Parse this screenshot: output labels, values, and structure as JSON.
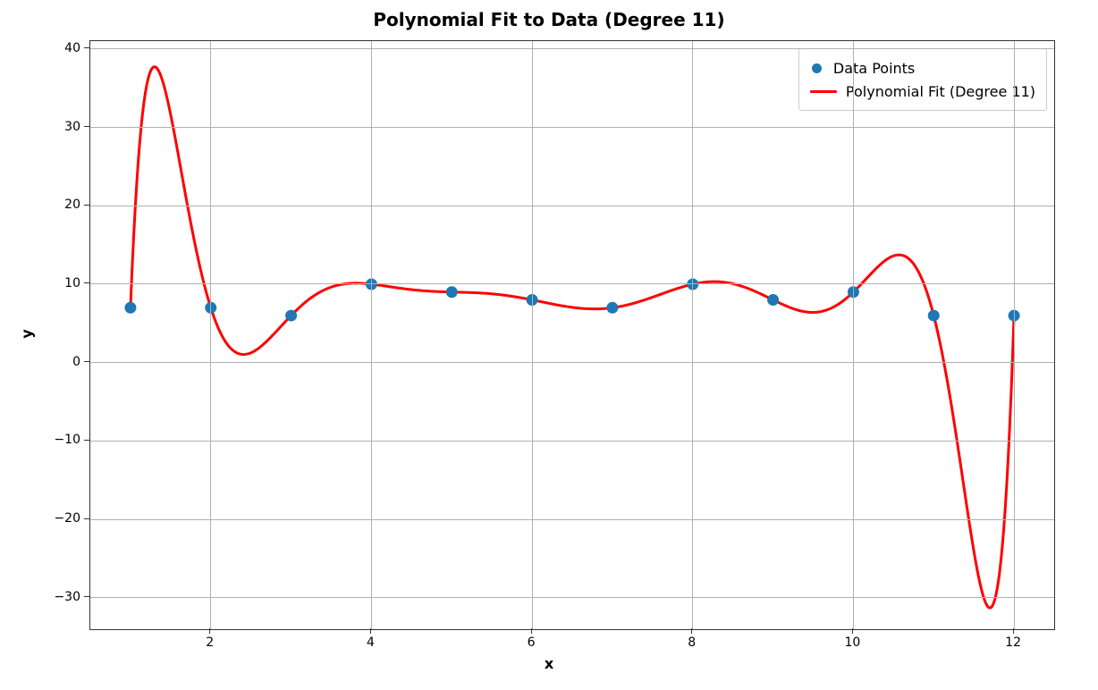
{
  "chart_data": {
    "type": "line",
    "title": "Polynomial Fit to Data (Degree 11)",
    "xlabel": "x",
    "ylabel": "y",
    "xticks": [
      2,
      4,
      6,
      8,
      10,
      12
    ],
    "yticks": [
      -30,
      -20,
      -10,
      0,
      10,
      20,
      30,
      40
    ],
    "xlim": [
      0.5,
      12.5
    ],
    "ylim": [
      -34,
      41
    ],
    "legend": {
      "points_label": "Data Points",
      "line_label": "Polynomial Fit (Degree 11)"
    },
    "series": [
      {
        "name": "Data Points",
        "type": "scatter",
        "color": "#1f77b4",
        "x": [
          1,
          2,
          3,
          4,
          5,
          6,
          7,
          8,
          9,
          10,
          11,
          12
        ],
        "y": [
          7,
          7,
          6,
          10,
          9,
          8,
          7,
          10,
          8,
          9,
          6,
          6
        ]
      },
      {
        "name": "Polynomial Fit (Degree 11)",
        "type": "line",
        "color": "#ff0000",
        "note": "Degree-11 polynomial that passes through all 12 data points, producing large oscillations near the edges (Runge-like): a peak near y≈37 around x≈1.3, a dip near y≈1 around x≈2.3, a peak near y≈14 around x≈10.5, and a deep trough near y≈-31 around x≈11.6."
      }
    ]
  }
}
